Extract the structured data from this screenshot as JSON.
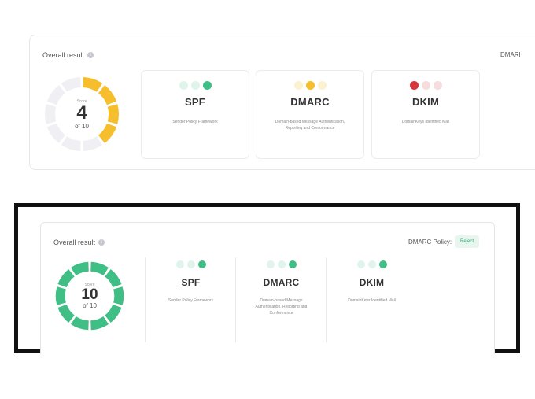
{
  "colors": {
    "green": "#3fbf85",
    "green_light": "#dff4ea",
    "amber": "#f6be2d",
    "amber_light": "#fcf2cf",
    "red": "#d6363c",
    "red_light": "#f7dcdd",
    "ring_empty": "#f0f0f4"
  },
  "before": {
    "overall_label": "Overall result",
    "policy_label_truncated": "DMARI",
    "gauge": {
      "caption": "Score",
      "score": "4",
      "out_of": "of 10",
      "score_value": 4,
      "max": 10
    },
    "cards": [
      {
        "title": "SPF",
        "description": "Sender Policy Framework",
        "dots": [
          "green_light",
          "green_light",
          "green"
        ]
      },
      {
        "title": "DMARC",
        "description_line1": "Domain-based Message Authentication,",
        "description_line2": "Reporting and Conformance",
        "dots": [
          "amber_light",
          "amber",
          "amber_light"
        ]
      },
      {
        "title": "DKIM",
        "description": "DomainKeys Identified Mail",
        "dots": [
          "red",
          "red_light",
          "red_light"
        ]
      }
    ]
  },
  "after": {
    "overall_label": "Overall result",
    "policy_label": "DMARC Policy:",
    "policy_value": "Reject",
    "gauge": {
      "caption": "Score",
      "score": "10",
      "out_of": "of 10",
      "score_value": 10,
      "max": 10
    },
    "cards": [
      {
        "title": "SPF",
        "description": "Sender Policy Framework",
        "dots": [
          "green_light",
          "green_light",
          "green"
        ]
      },
      {
        "title": "DMARC",
        "description_line1": "Domain-based Message",
        "description_line2": "Authentication, Reporting and",
        "description_line3": "Conformance",
        "dots": [
          "green_light",
          "green_light",
          "green"
        ]
      },
      {
        "title": "DKIM",
        "description": "DomainKeys Identified Mail",
        "dots": [
          "green_light",
          "green_light",
          "green"
        ]
      }
    ]
  }
}
